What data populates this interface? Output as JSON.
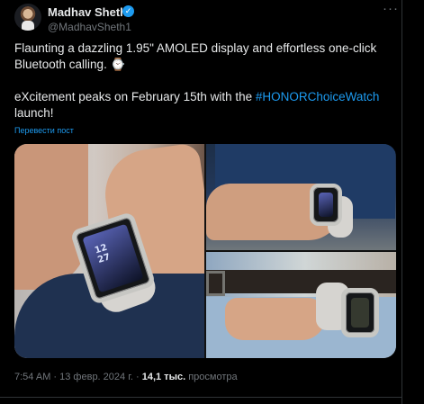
{
  "author": {
    "name": "Madhav Sheth",
    "handle": "@MadhavSheth1",
    "verified_icon": "verified-check-icon"
  },
  "tweet": {
    "line1": "Flaunting a dazzling 1.95\" AMOLED display and effortless one-click",
    "line2": "Bluetooth calling. ⌚",
    "line3_start": "eXcitement peaks on February 15th with the ",
    "hashtag": "#HONORChoiceWatch",
    "line4": "launch!"
  },
  "translate": "Перевести пост",
  "images": {
    "watch_time": "12\n27"
  },
  "meta": {
    "time": "7:54 AM",
    "separator1": " · ",
    "date": "13 февр. 2024 г.",
    "separator2": " · ",
    "views": "14,1 тыс.",
    "views_label": " просмотра"
  },
  "colors": {
    "background": "#000000",
    "text": "#e7e9ea",
    "muted": "#71767b",
    "accent": "#1d9bf0"
  }
}
